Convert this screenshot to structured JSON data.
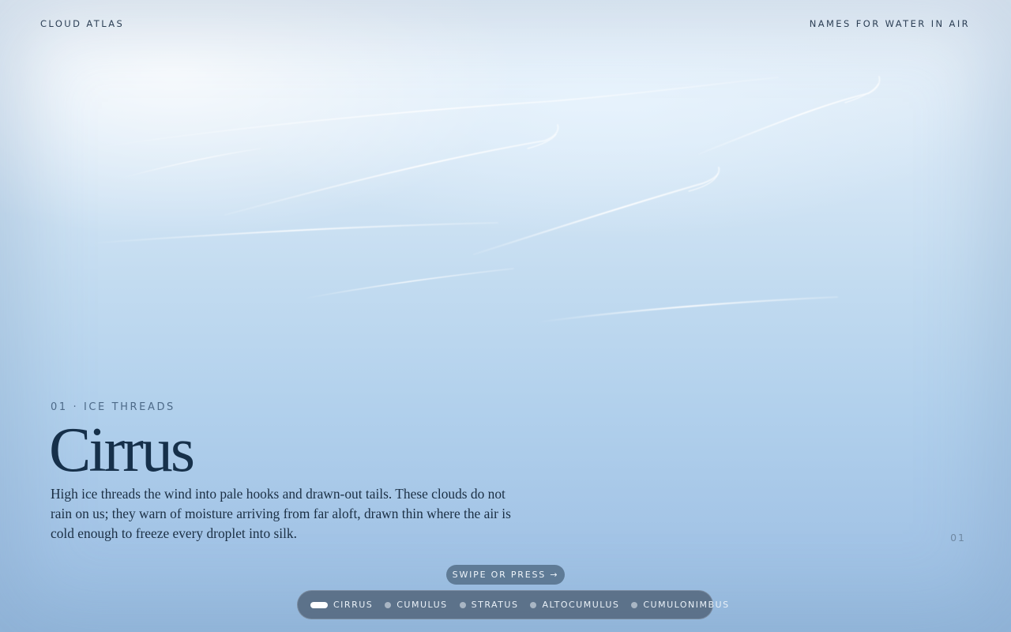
{
  "header": {
    "brand": "CLOUD ATLAS",
    "tagline": "NAMES FOR WATER IN AIR"
  },
  "slide": {
    "kicker": "01 · ICE THREADS",
    "title": "Cirrus",
    "description": "High ice threads the wind into pale hooks and drawn-out tails. These clouds do not rain on us; they warn of moisture arriving from far aloft, drawn thin where the air is cold enough to freeze every droplet into silk.",
    "number": "01"
  },
  "hint": {
    "label": "SWIPE OR PRESS →"
  },
  "nav": {
    "active_index": 0,
    "items": [
      {
        "label": "CIRRUS"
      },
      {
        "label": "CUMULUS"
      },
      {
        "label": "STRATUS"
      },
      {
        "label": "ALTOCUMULUS"
      },
      {
        "label": "CUMULONIMBUS"
      }
    ]
  },
  "colors": {
    "ink": "#16304a",
    "nav_background": "#54687e",
    "hint_background": "#5f7b96"
  }
}
